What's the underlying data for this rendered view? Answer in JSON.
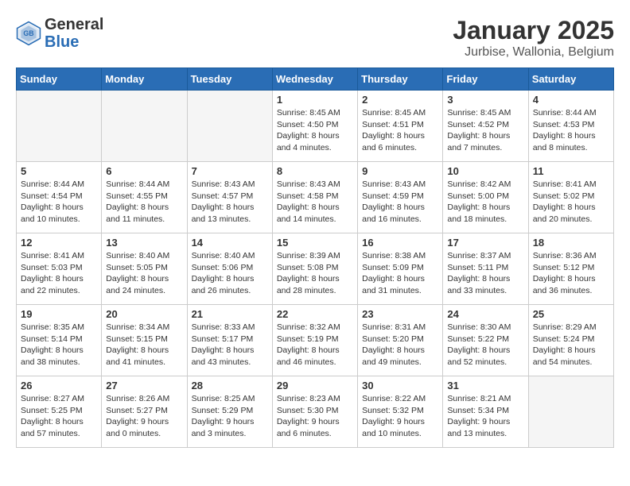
{
  "header": {
    "logo_general": "General",
    "logo_blue": "Blue",
    "title": "January 2025",
    "subtitle": "Jurbise, Wallonia, Belgium"
  },
  "weekdays": [
    "Sunday",
    "Monday",
    "Tuesday",
    "Wednesday",
    "Thursday",
    "Friday",
    "Saturday"
  ],
  "weeks": [
    [
      {
        "day": "",
        "info": ""
      },
      {
        "day": "",
        "info": ""
      },
      {
        "day": "",
        "info": ""
      },
      {
        "day": "1",
        "info": "Sunrise: 8:45 AM\nSunset: 4:50 PM\nDaylight: 8 hours\nand 4 minutes."
      },
      {
        "day": "2",
        "info": "Sunrise: 8:45 AM\nSunset: 4:51 PM\nDaylight: 8 hours\nand 6 minutes."
      },
      {
        "day": "3",
        "info": "Sunrise: 8:45 AM\nSunset: 4:52 PM\nDaylight: 8 hours\nand 7 minutes."
      },
      {
        "day": "4",
        "info": "Sunrise: 8:44 AM\nSunset: 4:53 PM\nDaylight: 8 hours\nand 8 minutes."
      }
    ],
    [
      {
        "day": "5",
        "info": "Sunrise: 8:44 AM\nSunset: 4:54 PM\nDaylight: 8 hours\nand 10 minutes."
      },
      {
        "day": "6",
        "info": "Sunrise: 8:44 AM\nSunset: 4:55 PM\nDaylight: 8 hours\nand 11 minutes."
      },
      {
        "day": "7",
        "info": "Sunrise: 8:43 AM\nSunset: 4:57 PM\nDaylight: 8 hours\nand 13 minutes."
      },
      {
        "day": "8",
        "info": "Sunrise: 8:43 AM\nSunset: 4:58 PM\nDaylight: 8 hours\nand 14 minutes."
      },
      {
        "day": "9",
        "info": "Sunrise: 8:43 AM\nSunset: 4:59 PM\nDaylight: 8 hours\nand 16 minutes."
      },
      {
        "day": "10",
        "info": "Sunrise: 8:42 AM\nSunset: 5:00 PM\nDaylight: 8 hours\nand 18 minutes."
      },
      {
        "day": "11",
        "info": "Sunrise: 8:41 AM\nSunset: 5:02 PM\nDaylight: 8 hours\nand 20 minutes."
      }
    ],
    [
      {
        "day": "12",
        "info": "Sunrise: 8:41 AM\nSunset: 5:03 PM\nDaylight: 8 hours\nand 22 minutes."
      },
      {
        "day": "13",
        "info": "Sunrise: 8:40 AM\nSunset: 5:05 PM\nDaylight: 8 hours\nand 24 minutes."
      },
      {
        "day": "14",
        "info": "Sunrise: 8:40 AM\nSunset: 5:06 PM\nDaylight: 8 hours\nand 26 minutes."
      },
      {
        "day": "15",
        "info": "Sunrise: 8:39 AM\nSunset: 5:08 PM\nDaylight: 8 hours\nand 28 minutes."
      },
      {
        "day": "16",
        "info": "Sunrise: 8:38 AM\nSunset: 5:09 PM\nDaylight: 8 hours\nand 31 minutes."
      },
      {
        "day": "17",
        "info": "Sunrise: 8:37 AM\nSunset: 5:11 PM\nDaylight: 8 hours\nand 33 minutes."
      },
      {
        "day": "18",
        "info": "Sunrise: 8:36 AM\nSunset: 5:12 PM\nDaylight: 8 hours\nand 36 minutes."
      }
    ],
    [
      {
        "day": "19",
        "info": "Sunrise: 8:35 AM\nSunset: 5:14 PM\nDaylight: 8 hours\nand 38 minutes."
      },
      {
        "day": "20",
        "info": "Sunrise: 8:34 AM\nSunset: 5:15 PM\nDaylight: 8 hours\nand 41 minutes."
      },
      {
        "day": "21",
        "info": "Sunrise: 8:33 AM\nSunset: 5:17 PM\nDaylight: 8 hours\nand 43 minutes."
      },
      {
        "day": "22",
        "info": "Sunrise: 8:32 AM\nSunset: 5:19 PM\nDaylight: 8 hours\nand 46 minutes."
      },
      {
        "day": "23",
        "info": "Sunrise: 8:31 AM\nSunset: 5:20 PM\nDaylight: 8 hours\nand 49 minutes."
      },
      {
        "day": "24",
        "info": "Sunrise: 8:30 AM\nSunset: 5:22 PM\nDaylight: 8 hours\nand 52 minutes."
      },
      {
        "day": "25",
        "info": "Sunrise: 8:29 AM\nSunset: 5:24 PM\nDaylight: 8 hours\nand 54 minutes."
      }
    ],
    [
      {
        "day": "26",
        "info": "Sunrise: 8:27 AM\nSunset: 5:25 PM\nDaylight: 8 hours\nand 57 minutes."
      },
      {
        "day": "27",
        "info": "Sunrise: 8:26 AM\nSunset: 5:27 PM\nDaylight: 9 hours\nand 0 minutes."
      },
      {
        "day": "28",
        "info": "Sunrise: 8:25 AM\nSunset: 5:29 PM\nDaylight: 9 hours\nand 3 minutes."
      },
      {
        "day": "29",
        "info": "Sunrise: 8:23 AM\nSunset: 5:30 PM\nDaylight: 9 hours\nand 6 minutes."
      },
      {
        "day": "30",
        "info": "Sunrise: 8:22 AM\nSunset: 5:32 PM\nDaylight: 9 hours\nand 10 minutes."
      },
      {
        "day": "31",
        "info": "Sunrise: 8:21 AM\nSunset: 5:34 PM\nDaylight: 9 hours\nand 13 minutes."
      },
      {
        "day": "",
        "info": ""
      }
    ]
  ]
}
